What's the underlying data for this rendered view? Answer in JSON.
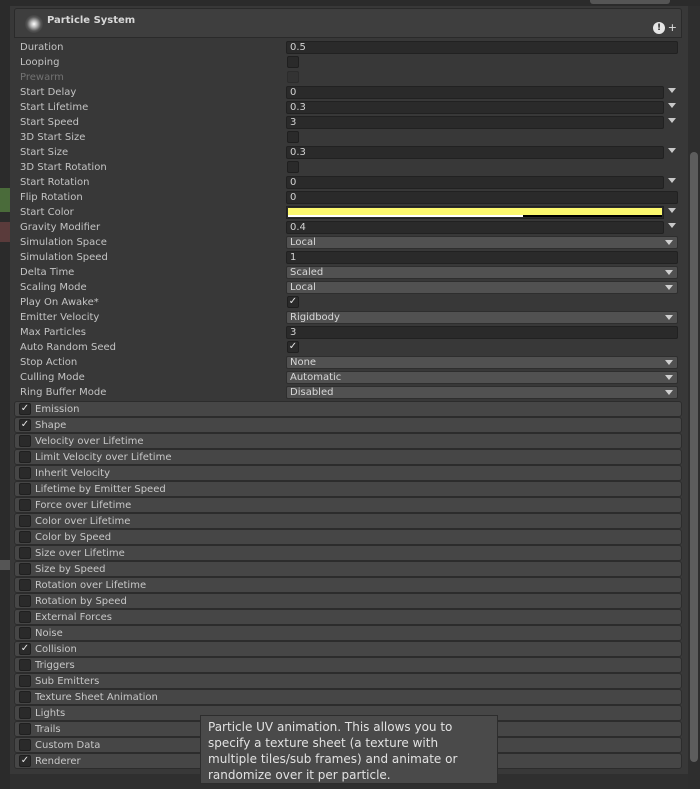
{
  "component": {
    "title": "Particle System",
    "warning_glyph": "!",
    "add_glyph": "+"
  },
  "properties": [
    {
      "label": "Duration",
      "type": "field",
      "value": "0.5"
    },
    {
      "label": "Looping",
      "type": "check",
      "checked": false
    },
    {
      "label": "Prewarm",
      "type": "check",
      "checked": false,
      "disabled": true
    },
    {
      "label": "Start Delay",
      "type": "curve",
      "value": "0"
    },
    {
      "label": "Start Lifetime",
      "type": "curve",
      "value": "0.3"
    },
    {
      "label": "Start Speed",
      "type": "curve",
      "value": "3"
    },
    {
      "label": "3D Start Size",
      "type": "check",
      "checked": false
    },
    {
      "label": "Start Size",
      "type": "curve",
      "value": "0.3"
    },
    {
      "label": "3D Start Rotation",
      "type": "check",
      "checked": false
    },
    {
      "label": "Start Rotation",
      "type": "curve",
      "value": "0"
    },
    {
      "label": "Flip Rotation",
      "type": "field",
      "value": "0"
    },
    {
      "label": "Start Color",
      "type": "color",
      "color": "#fcf86e",
      "alpha": 0.63
    },
    {
      "label": "Gravity Modifier",
      "type": "curve",
      "value": "0.4"
    },
    {
      "label": "Simulation Space",
      "type": "dropdown",
      "value": "Local"
    },
    {
      "label": "Simulation Speed",
      "type": "field",
      "value": "1"
    },
    {
      "label": "Delta Time",
      "type": "dropdown",
      "value": "Scaled"
    },
    {
      "label": "Scaling Mode",
      "type": "dropdown",
      "value": "Local"
    },
    {
      "label": "Play On Awake*",
      "type": "check",
      "checked": true
    },
    {
      "label": "Emitter Velocity",
      "type": "dropdown",
      "value": "Rigidbody"
    },
    {
      "label": "Max Particles",
      "type": "field",
      "value": "3"
    },
    {
      "label": "Auto Random Seed",
      "type": "check",
      "checked": true
    },
    {
      "label": "Stop Action",
      "type": "dropdown",
      "value": "None"
    },
    {
      "label": "Culling Mode",
      "type": "dropdown",
      "value": "Automatic"
    },
    {
      "label": "Ring Buffer Mode",
      "type": "dropdown",
      "value": "Disabled"
    }
  ],
  "modules": [
    {
      "label": "Emission",
      "checked": true
    },
    {
      "label": "Shape",
      "checked": true
    },
    {
      "label": "Velocity over Lifetime",
      "checked": false
    },
    {
      "label": "Limit Velocity over Lifetime",
      "checked": false
    },
    {
      "label": "Inherit Velocity",
      "checked": false
    },
    {
      "label": "Lifetime by Emitter Speed",
      "checked": false
    },
    {
      "label": "Force over Lifetime",
      "checked": false
    },
    {
      "label": "Color over Lifetime",
      "checked": false
    },
    {
      "label": "Color by Speed",
      "checked": false
    },
    {
      "label": "Size over Lifetime",
      "checked": false
    },
    {
      "label": "Size by Speed",
      "checked": false
    },
    {
      "label": "Rotation over Lifetime",
      "checked": false
    },
    {
      "label": "Rotation by Speed",
      "checked": false
    },
    {
      "label": "External Forces",
      "checked": false
    },
    {
      "label": "Noise",
      "checked": false
    },
    {
      "label": "Collision",
      "checked": true
    },
    {
      "label": "Triggers",
      "checked": false
    },
    {
      "label": "Sub Emitters",
      "checked": false
    },
    {
      "label": "Texture Sheet Animation",
      "checked": false
    },
    {
      "label": "Lights",
      "checked": false
    },
    {
      "label": "Trails",
      "checked": false
    },
    {
      "label": "Custom Data",
      "checked": false
    },
    {
      "label": "Renderer",
      "checked": true
    }
  ],
  "check_glyph": "✓",
  "tooltip": {
    "text": "Particle UV animation. This allows you to specify a texture sheet (a texture with multiple tiles/sub frames) and animate or randomize over it per particle."
  },
  "colors": {
    "panel_bg": "#383838",
    "module_bg": "#464646",
    "field_bg": "#2a2a2a",
    "dropdown_bg": "#515151",
    "start_color": "#fcf86e"
  }
}
